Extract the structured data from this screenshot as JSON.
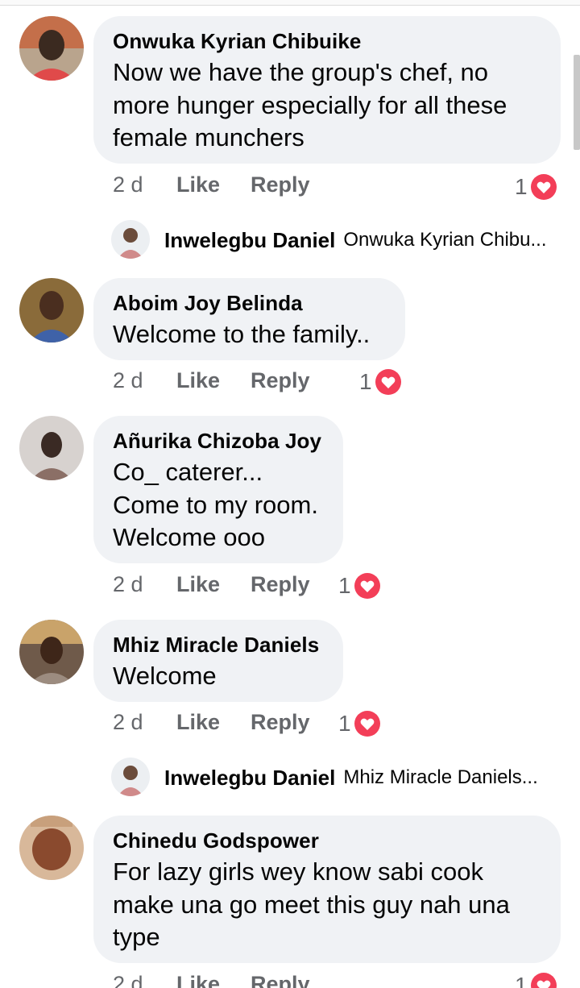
{
  "comments": [
    {
      "author": "Onwuka Kyrian Chibuike",
      "text": "Now we have the group's chef, no\nmore hunger especially for all these\nfemale munchers",
      "time": "2 d",
      "like": "Like",
      "reply": "Reply",
      "reactions": "1",
      "avatar_icon": "person-red-shirt-avatar"
    },
    {
      "author": "Aboim Joy Belinda",
      "text": "Welcome to the family..",
      "time": "2 d",
      "like": "Like",
      "reply": "Reply",
      "reactions": "1",
      "avatar_icon": "person-avatar"
    },
    {
      "author": "Añurika Chizoba Joy",
      "text": "Co_ caterer...\nCome to my room.\nWelcome ooo",
      "time": "2 d",
      "like": "Like",
      "reply": "Reply",
      "reactions": "1",
      "avatar_icon": "person-avatar"
    },
    {
      "author": "Mhiz Miracle Daniels",
      "text": "Welcome",
      "time": "2 d",
      "like": "Like",
      "reply": "Reply",
      "reactions": "1",
      "avatar_icon": "person-avatar"
    },
    {
      "author": "Chinedu Godspower",
      "text": "For lazy girls wey know sabi cook\nmake una go meet this guy nah una\ntype",
      "time": "2 d",
      "like": "Like",
      "reply": "Reply",
      "reactions": "1",
      "avatar_icon": "person-avatar"
    }
  ],
  "replies": [
    {
      "author": "Inwelegbu Daniel",
      "preview": "Onwuka Kyrian Chibu...",
      "avatar_icon": "person-avatar"
    },
    {
      "author": "Inwelegbu Daniel",
      "preview": "Mhiz Miracle Daniels...",
      "avatar_icon": "person-avatar"
    }
  ],
  "colors": {
    "bubble": "#f0f2f5",
    "heart": "#f33e58",
    "meta_text": "#65676b",
    "text": "#050505"
  }
}
